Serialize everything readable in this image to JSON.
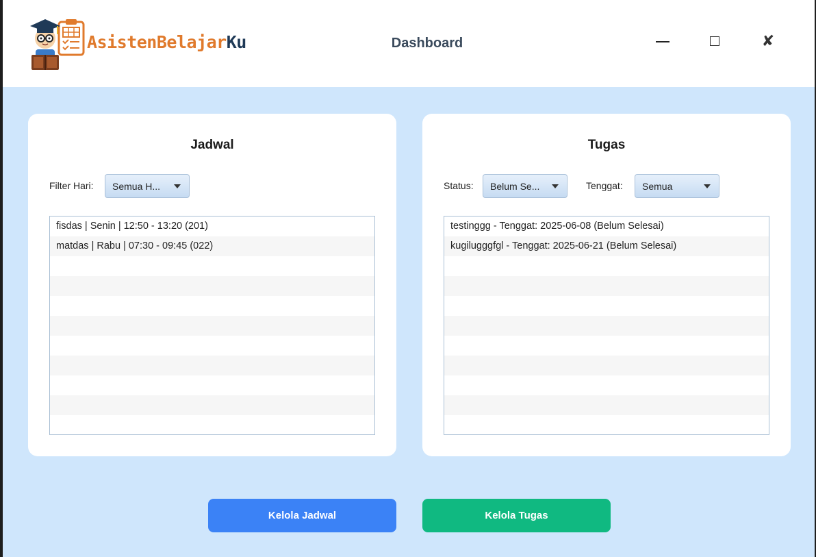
{
  "header": {
    "logo_text_1": "Asisten",
    "logo_text_2": "Belajar",
    "logo_text_3": "Ku",
    "title": "Dashboard"
  },
  "window_controls": {
    "close_glyph": "✘"
  },
  "jadwal": {
    "title": "Jadwal",
    "filter_label": "Filter Hari:",
    "filter_value": "Semua H...",
    "items": [
      "fisdas | Senin | 12:50 - 13:20 (201)",
      "matdas | Rabu | 07:30 - 09:45 (022)"
    ]
  },
  "tugas": {
    "title": "Tugas",
    "status_label": "Status:",
    "status_value": "Belum Se...",
    "tenggat_label": "Tenggat:",
    "tenggat_value": "Semua",
    "items": [
      "testinggg - Tenggat: 2025-06-08 (Belum Selesai)",
      "kugilugggfgl - Tenggat: 2025-06-21 (Belum Selesai)"
    ]
  },
  "actions": {
    "kelola_jadwal": "Kelola Jadwal",
    "kelola_tugas": "Kelola Tugas"
  },
  "colors": {
    "background": "#cfe6fc",
    "jadwal_button": "#3b82f6",
    "tugas_button": "#10b981",
    "logo_orange": "#e07a2c",
    "logo_navy": "#1f3a57"
  }
}
